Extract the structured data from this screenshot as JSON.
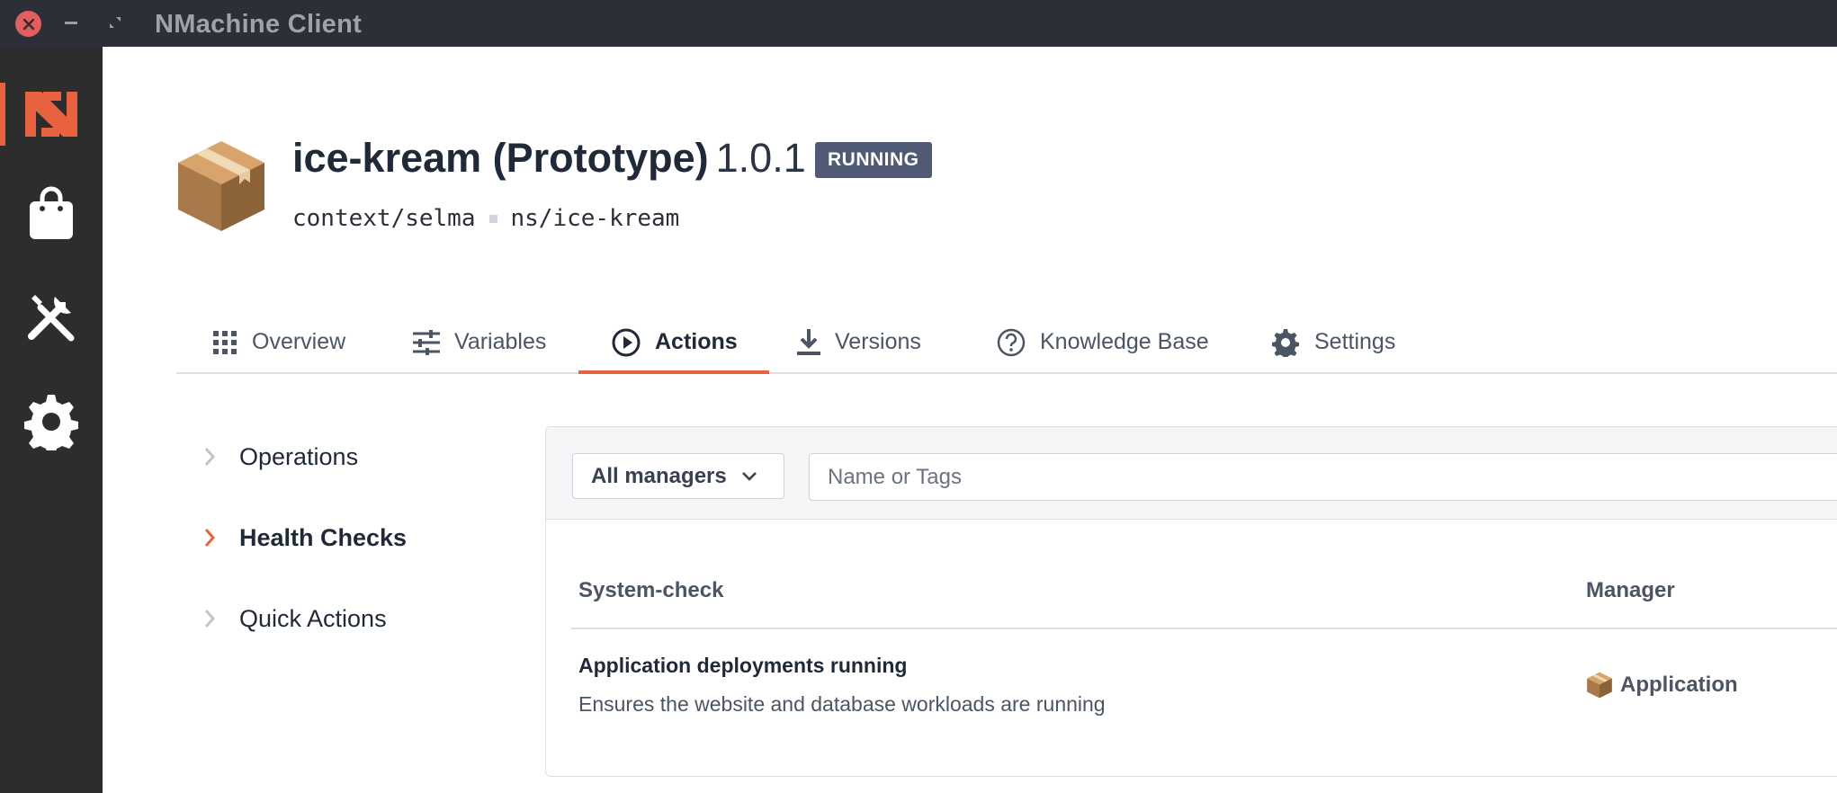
{
  "window": {
    "title": "NMachine Client"
  },
  "sidebar": {
    "items": [
      {
        "name": "logo",
        "icon": "nmachine-logo-icon",
        "active": true
      },
      {
        "name": "store",
        "icon": "shopping-bag-icon"
      },
      {
        "name": "tools",
        "icon": "tools-icon"
      },
      {
        "name": "settings",
        "icon": "gear-icon"
      }
    ],
    "accent_color": "#e8623f"
  },
  "header": {
    "app_name": "ice-kream (Prototype)",
    "version": "1.0.1",
    "status": "RUNNING",
    "context": "context/selma",
    "namespace": "ns/ice-kream"
  },
  "tabs": [
    {
      "label": "Overview",
      "icon": "grid-icon"
    },
    {
      "label": "Variables",
      "icon": "sliders-icon"
    },
    {
      "label": "Actions",
      "icon": "play-circle-icon",
      "active": true
    },
    {
      "label": "Versions",
      "icon": "download-icon"
    },
    {
      "label": "Knowledge Base",
      "icon": "help-circle-icon"
    },
    {
      "label": "Settings",
      "icon": "cog-icon"
    }
  ],
  "submenu": [
    {
      "label": "Operations"
    },
    {
      "label": "Health Checks",
      "active": true
    },
    {
      "label": "Quick Actions"
    }
  ],
  "filters": {
    "manager_select": "All managers",
    "search_placeholder": "Name or Tags"
  },
  "table": {
    "columns": [
      "System-check",
      "Manager"
    ],
    "rows": [
      {
        "title": "Application deployments running",
        "description": "Ensures the website and database workloads are running",
        "manager": "Application"
      }
    ]
  }
}
